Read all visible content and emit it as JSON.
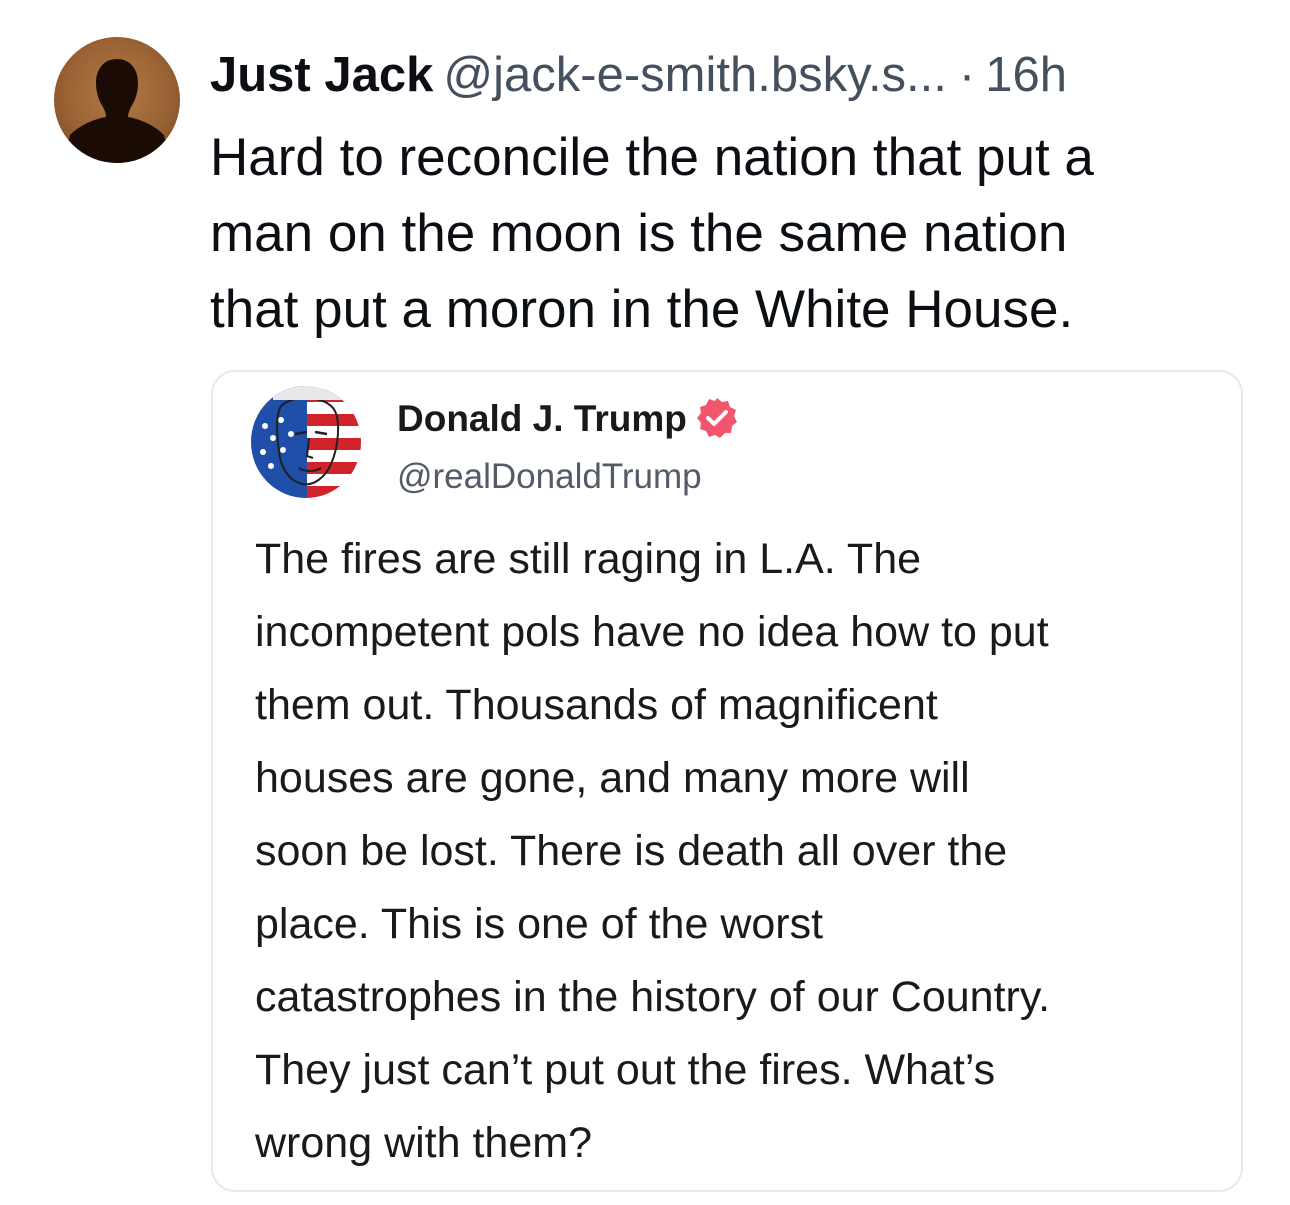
{
  "post": {
    "author": {
      "display_name": "Just Jack",
      "handle": "@jack-e-smith.bsky.s...",
      "separator": "·",
      "time": "16h",
      "avatar_icon": "silhouette-avatar"
    },
    "text_lines": [
      "Hard to reconcile the nation that put a",
      "man on the moon is the same nation",
      "that put a moron in the White House."
    ]
  },
  "quote": {
    "author": {
      "display_name": "Donald J. Trump",
      "handle": "@realDonaldTrump",
      "verified_icon": "verified-badge-icon",
      "verified_color": "#f2566f",
      "avatar_icon": "flag-face-avatar"
    },
    "text_lines": [
      "The fires are still raging in L.A. The",
      "incompetent pols have no idea how to put",
      "them out. Thousands of magnificent",
      "houses are gone, and many more will",
      "soon be lost. There is death all over the",
      "place. This is one of the worst",
      "catastrophes in the history of our Country.",
      "They just can’t put out the fires. What’s",
      "wrong with them?"
    ]
  },
  "colors": {
    "text_primary": "#0b0f14",
    "text_secondary": "#45505e",
    "card_border": "#e6e9ee"
  }
}
